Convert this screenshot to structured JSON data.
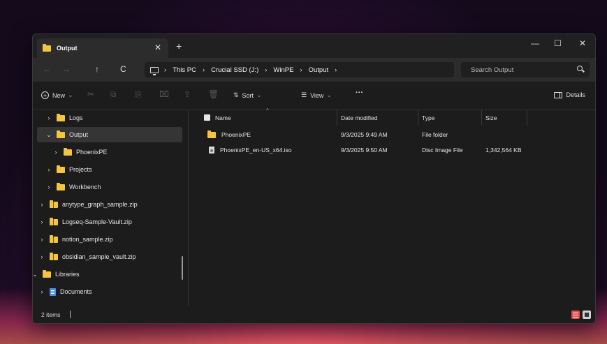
{
  "window": {
    "tab_title": "Output",
    "tab_close": "✕",
    "new_tab": "+",
    "minimize": "—",
    "maximize": "☐",
    "close": "✕"
  },
  "nav": {
    "back": "←",
    "forward": "→",
    "up": "↑",
    "refresh": "C"
  },
  "breadcrumb": [
    "This PC",
    "Crucial SSD (J:)",
    "WinPE",
    "Output"
  ],
  "breadcrumb_sep": "›",
  "search": {
    "placeholder": "Search Output"
  },
  "commands": {
    "new": "New",
    "sort": "Sort",
    "view": "View",
    "more": "···",
    "details": "Details",
    "dropdown": "⌄"
  },
  "sidebar": {
    "items": [
      {
        "label": "Logs",
        "chevron": "›"
      },
      {
        "label": "Output",
        "chevron": "⌄"
      },
      {
        "label": "PhoenixPE",
        "chevron": "›"
      },
      {
        "label": "Projects",
        "chevron": "›"
      },
      {
        "label": "Workbench",
        "chevron": "›"
      },
      {
        "label": "anytype_graph_sample.zip",
        "chevron": "›"
      },
      {
        "label": "Logseq-Sample-Vault.zip",
        "chevron": "›"
      },
      {
        "label": "notion_sample.zip",
        "chevron": "›"
      },
      {
        "label": "obsidian_sample_vault.zip",
        "chevron": "›"
      },
      {
        "label": "Libraries",
        "chevron": "⌄"
      },
      {
        "label": "Documents",
        "chevron": "›"
      }
    ]
  },
  "filelist": {
    "columns": {
      "name": "Name",
      "date": "Date modified",
      "type": "Type",
      "size": "Size"
    },
    "rows": [
      {
        "name": "PhoenixPE",
        "date": "9/3/2025 9:49 AM",
        "type": "File folder",
        "size": ""
      },
      {
        "name": "PhoenixPE_en-US_x64.iso",
        "date": "9/3/2025 9:50 AM",
        "type": "Disc Image File",
        "size": "1,342,564 KB"
      }
    ]
  },
  "status": {
    "count": "2 items"
  },
  "colors": {
    "folder": "#f5c542",
    "background": "#1c1c1c",
    "selected": "#353535"
  }
}
